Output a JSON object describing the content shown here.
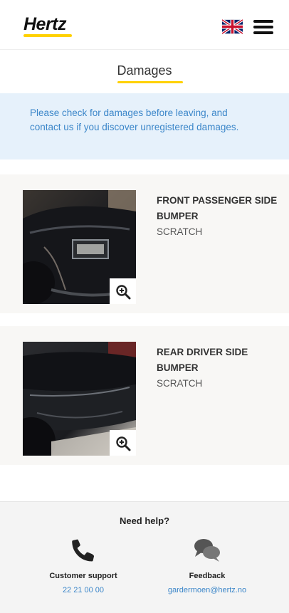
{
  "header": {
    "logo_text": "Hertz",
    "language_flag": "uk-flag-icon",
    "menu_icon": "hamburger-menu-icon"
  },
  "page": {
    "title": "Damages"
  },
  "info": {
    "message": "Please check for damages before leaving, and contact us if you discover unregistered damages."
  },
  "damages": [
    {
      "location": "FRONT PASSENGER SIDE BUMPER",
      "type": "SCRATCH",
      "zoom_icon": "zoom-in-icon"
    },
    {
      "location": "REAR DRIVER SIDE BUMPER",
      "type": "SCRATCH",
      "zoom_icon": "zoom-in-icon"
    }
  ],
  "footer": {
    "help_title": "Need help?",
    "support": {
      "label": "Customer support",
      "value": "22 21 00 00",
      "icon": "phone-icon"
    },
    "feedback": {
      "label": "Feedback",
      "value": "gardermoen@hertz.no",
      "icon": "chat-bubbles-icon"
    }
  },
  "colors": {
    "brand_yellow": "#ffd100",
    "info_background": "#e6f1fb",
    "info_text": "#3b86c9",
    "link_blue": "#3b86c9"
  }
}
